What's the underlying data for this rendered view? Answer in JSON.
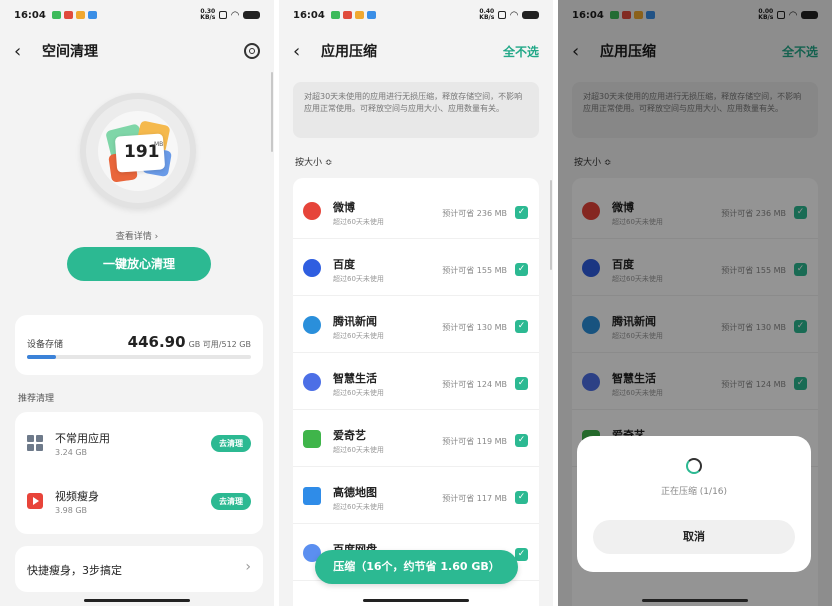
{
  "status_bar": {
    "time": "16:04",
    "net_p1": "0.30",
    "net_p2": "0.40",
    "net_p3": "0.00",
    "net_unit": "KB/s"
  },
  "panel1": {
    "title": "空间清理",
    "junk_value": "191",
    "junk_unit": "MB",
    "detail_link": "查看详情 ›",
    "primary_button": "一键放心清理",
    "storage": {
      "label": "设备存储",
      "available": "446.90",
      "suffix": "GB 可用/512 GB",
      "used_fraction": 0.13
    },
    "section_title": "推荐清理",
    "recommendations": [
      {
        "name": "不常用应用",
        "size": "3.24 GB",
        "action": "去清理",
        "icon": "grid-apps-icon"
      },
      {
        "name": "视频瘦身",
        "size": "3.98 GB",
        "action": "去清理",
        "icon": "video-icon"
      }
    ],
    "quick": {
      "label": "快捷瘦身，3步搞定"
    }
  },
  "panel2": {
    "title": "应用压缩",
    "deselect_all": "全不选",
    "notice": "对超30天未使用的应用进行无损压缩，释放存储空间，不影响应用正常使用。可释放空间与应用大小、应用数量有关。",
    "sort_label": "按大小 ≎",
    "apps": [
      {
        "name": "微博",
        "sub": "超过60天未使用",
        "estimate": "预计可省 236 MB",
        "color": "#e6443a"
      },
      {
        "name": "百度",
        "sub": "超过60天未使用",
        "estimate": "预计可省 155 MB",
        "color": "#2f5ee0"
      },
      {
        "name": "腾讯新闻",
        "sub": "超过60天未使用",
        "estimate": "预计可省 130 MB",
        "color": "#2a8fdb"
      },
      {
        "name": "智慧生活",
        "sub": "超过60天未使用",
        "estimate": "预计可省 124 MB",
        "color": "#4c6fe6"
      },
      {
        "name": "爱奇艺",
        "sub": "超过60天未使用",
        "estimate": "预计可省 119 MB",
        "color": "#3fb54a"
      },
      {
        "name": "高德地图",
        "sub": "超过60天未使用",
        "estimate": "预计可省 117 MB",
        "color": "#2f8ce8"
      },
      {
        "name": "百度网盘",
        "sub": "",
        "estimate": "",
        "color": "#5b8ff0"
      }
    ],
    "compress_button": "压缩（16个，约节省 1.60 GB）"
  },
  "panel3": {
    "title": "应用压缩",
    "deselect_all": "全不选",
    "apps_visible": [
      {
        "name": "微博",
        "sub": "超过60天未使用",
        "estimate": "预计可省 236 MB"
      },
      {
        "name": "百度",
        "sub": "超过60天未使用",
        "estimate": "预计可省 155 MB"
      },
      {
        "name": "腾讯新闻",
        "sub": "超过60天未使用",
        "estimate": "预计可省 130 MB"
      },
      {
        "name": "智慧生活",
        "sub": "超过60天未使用",
        "estimate": "预计可省 124 MB"
      },
      {
        "name": "爱奇艺",
        "sub": "",
        "estimate": ""
      }
    ],
    "dialog": {
      "status": "正在压缩 (1/16)",
      "cancel": "取消"
    }
  }
}
